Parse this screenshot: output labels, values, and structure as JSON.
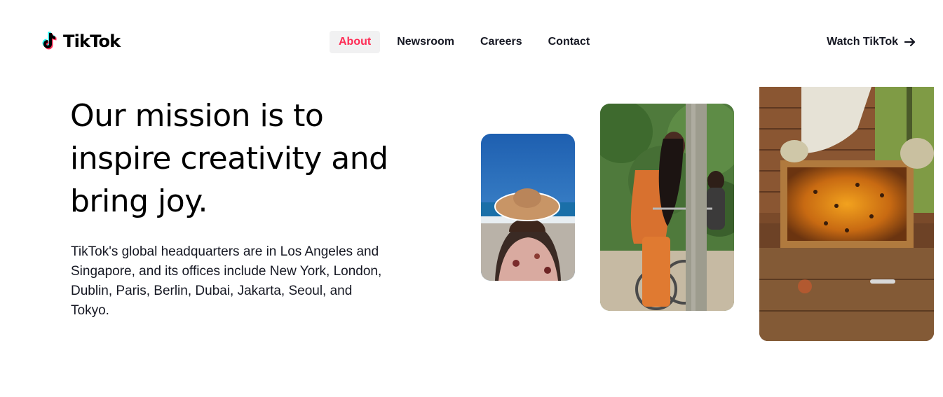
{
  "brand": {
    "name": "TikTok"
  },
  "nav": {
    "items": [
      {
        "label": "About",
        "active": true
      },
      {
        "label": "Newsroom",
        "active": false
      },
      {
        "label": "Careers",
        "active": false
      },
      {
        "label": "Contact",
        "active": false
      }
    ],
    "cta_label": "Watch TikTok",
    "cta_icon": "arrow-right-icon"
  },
  "hero": {
    "title": "Our mission is to inspire creativity and bring joy.",
    "description": "TikTok's global headquarters are in Los Angeles and Singapore, and its offices include New York, London, Dublin, Paris, Berlin, Dubai, Jakarta, Seoul, and Tokyo."
  },
  "colors": {
    "accent": "#fe2c55",
    "cyan": "#25f4ee",
    "text": "#161823",
    "active_bg": "#f1f1f2"
  }
}
